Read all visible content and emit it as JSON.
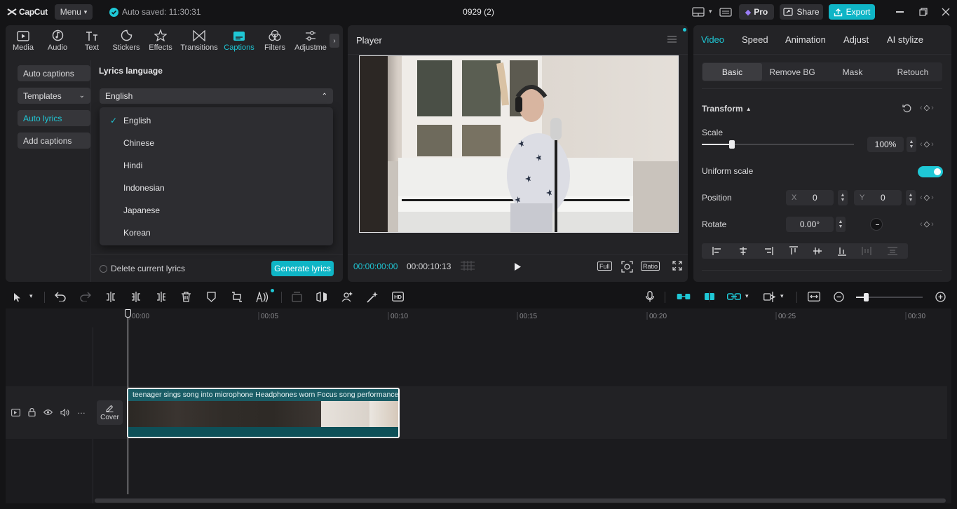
{
  "app": {
    "logo": "CapCut",
    "menu_label": "Menu",
    "autosave_text": "Auto saved: 11:30:31",
    "project_title": "0929 (2)"
  },
  "header_buttons": {
    "pro": "Pro",
    "share": "Share",
    "export": "Export"
  },
  "toolbar": {
    "items": [
      "Media",
      "Audio",
      "Text",
      "Stickers",
      "Effects",
      "Transitions",
      "Captions",
      "Filters",
      "Adjustme"
    ],
    "active": "Captions"
  },
  "captions_menu": {
    "items": [
      "Auto captions",
      "Templates",
      "Auto lyrics",
      "Add captions"
    ],
    "active": "Auto lyrics"
  },
  "lyrics": {
    "section_title": "Lyrics language",
    "selected_language": "English",
    "options": [
      "English",
      "Chinese",
      "Hindi",
      "Indonesian",
      "Japanese",
      "Korean"
    ],
    "delete_label": "Delete current lyrics",
    "generate_label": "Generate lyrics"
  },
  "player": {
    "title": "Player",
    "current_time": "00:00:00:00",
    "total_time": "00:00:10:13",
    "full_label": "Full",
    "ratio_label": "Ratio"
  },
  "inspector": {
    "tabs": [
      "Video",
      "Speed",
      "Animation",
      "Adjust",
      "AI stylize"
    ],
    "active_tab": "Video",
    "subtabs": [
      "Basic",
      "Remove BG",
      "Mask",
      "Retouch"
    ],
    "active_subtab": "Basic",
    "transform_label": "Transform",
    "scale_label": "Scale",
    "scale_value": "100%",
    "scale_level": 0.2,
    "uniform_scale_label": "Uniform scale",
    "uniform_scale_on": true,
    "position_label": "Position",
    "pos_x_label": "X",
    "pos_x": "0",
    "pos_y_label": "Y",
    "pos_y": "0",
    "rotate_label": "Rotate",
    "rotate_value": "0.00°"
  },
  "timeline": {
    "ticks": [
      "00:00",
      "00:05",
      "00:10",
      "00:15",
      "00:20",
      "00:25",
      "00:30"
    ],
    "cover_label": "Cover",
    "clip_title": "teenager sings song into microphone Headphones worn Focus song performance"
  },
  "colors": {
    "accent": "#1fc8d6",
    "export": "#0fb5c6",
    "panel": "#232326",
    "bg": "#141416"
  }
}
